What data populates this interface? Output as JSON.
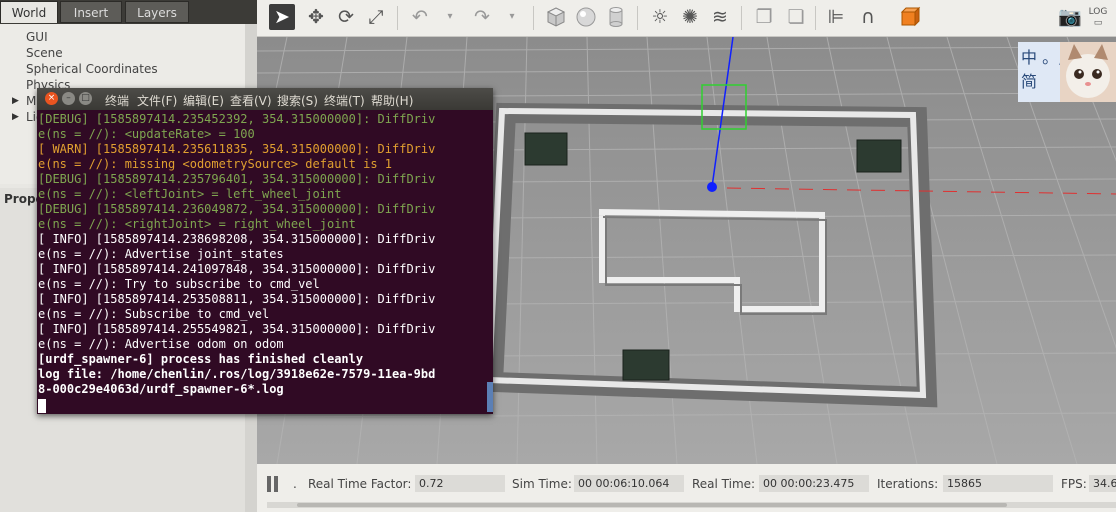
{
  "left_panel": {
    "tabs": [
      "World",
      "Insert",
      "Layers"
    ],
    "tree": [
      "GUI",
      "Scene",
      "Spherical Coordinates",
      "Physics",
      "Models",
      "Lights"
    ],
    "property_label": "Prope"
  },
  "toolbar": {
    "icons": [
      "select-arrow-icon",
      "translate-icon",
      "rotate-icon",
      "scale-icon",
      "undo-icon",
      "redo-icon",
      "box-icon",
      "sphere-icon",
      "cylinder-icon",
      "sun-light-icon",
      "point-light-icon",
      "spot-light-icon",
      "copy-icon",
      "paste-icon",
      "align-icon",
      "snap-magnet-icon",
      "color-cube-icon",
      "screenshot-icon",
      "log-icon"
    ]
  },
  "terminal": {
    "menu": [
      "终端",
      "文件(F)",
      "编辑(E)",
      "查看(V)",
      "搜索(S)",
      "终端(T)",
      "帮助(H)"
    ],
    "lines": [
      {
        "t": "[DEBUG] [1585897414.235452392, 354.315000000]: DiffDriv",
        "c": "debug"
      },
      {
        "t": "e(ns = //): <updateRate> = 100",
        "c": "debug"
      },
      {
        "t": "[ WARN] [1585897414.235611835, 354.315000000]: DiffDriv",
        "c": "warn"
      },
      {
        "t": "e(ns = //): missing <odometrySource> default is 1",
        "c": "warn"
      },
      {
        "t": "[DEBUG] [1585897414.235796401, 354.315000000]: DiffDriv",
        "c": "debug"
      },
      {
        "t": "e(ns = //): <leftJoint> = left_wheel_joint",
        "c": "debug"
      },
      {
        "t": "[DEBUG] [1585897414.236049872, 354.315000000]: DiffDriv",
        "c": "debug"
      },
      {
        "t": "e(ns = //): <rightJoint> = right_wheel_joint",
        "c": "debug"
      },
      {
        "t": "[ INFO] [1585897414.238698208, 354.315000000]: DiffDriv",
        "c": "info"
      },
      {
        "t": "e(ns = //): Advertise joint_states",
        "c": "info"
      },
      {
        "t": "[ INFO] [1585897414.241097848, 354.315000000]: DiffDriv",
        "c": "info"
      },
      {
        "t": "e(ns = //): Try to subscribe to cmd_vel",
        "c": "info"
      },
      {
        "t": "[ INFO] [1585897414.253508811, 354.315000000]: DiffDriv",
        "c": "info"
      },
      {
        "t": "e(ns = //): Subscribe to cmd_vel",
        "c": "info"
      },
      {
        "t": "[ INFO] [1585897414.255549821, 354.315000000]: DiffDriv",
        "c": "info"
      },
      {
        "t": "e(ns = //): Advertise odom on odom",
        "c": "info"
      },
      {
        "t": "[urdf_spawner-6] process has finished cleanly",
        "c": "bold"
      },
      {
        "t": "log file: /home/chenlin/.ros/log/3918e62e-7579-11ea-9bd",
        "c": "bold"
      },
      {
        "t": "8-000c29e4063d/urdf_spawner-6*.log",
        "c": "bold"
      }
    ]
  },
  "status": {
    "real_time_factor_label": "Real Time Factor:",
    "real_time_factor": "0.72",
    "sim_time_label": "Sim Time:",
    "sim_time": "00 00:06:10.064",
    "real_time_label": "Real Time:",
    "real_time": "00 00:00:23.475",
    "iterations_label": "Iterations:",
    "iterations": "15865",
    "fps_label": "FPS:",
    "fps": "34.6",
    "step_label": "."
  },
  "ime": {
    "line1": "中 。,",
    "line2": "简"
  }
}
